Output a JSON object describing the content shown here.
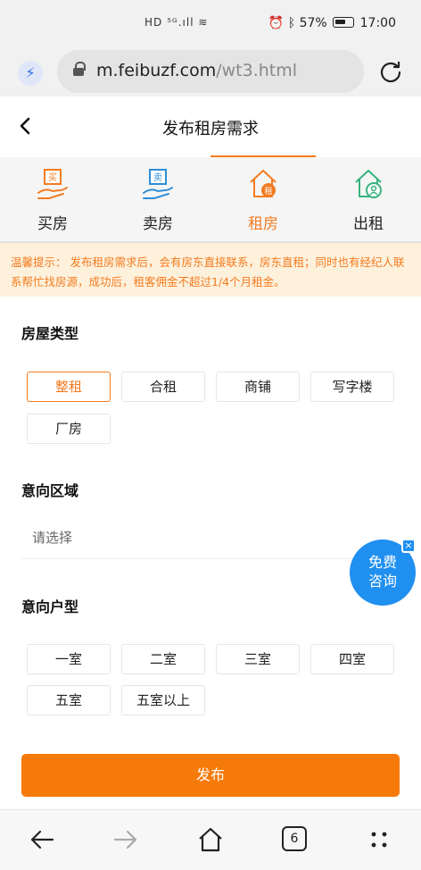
{
  "status_bar": {
    "signal_text": "HD ⁵ᴳ.ıll ≋",
    "battery_text": "57%",
    "time": "17:00"
  },
  "address_bar": {
    "host": "m.feibuzf.com",
    "path": "/wt3.html"
  },
  "header": {
    "title": "发布租房需求"
  },
  "categories": [
    {
      "label": "买房",
      "icon": "buy-house-icon",
      "color": "#f47b20"
    },
    {
      "label": "卖房",
      "icon": "sell-house-icon",
      "color": "#2f8fd8"
    },
    {
      "label": "租房",
      "icon": "rent-house-icon",
      "color": "#f47b20",
      "active": true
    },
    {
      "label": "出租",
      "icon": "lease-house-icon",
      "color": "#36b37e"
    }
  ],
  "tip": {
    "text": "温馨提示：  发布租房需求后，会有房东直接联系，房东直租；同时也有经纪人联系帮忙找房源，成功后，租客佣金不超过1/4个月租金。"
  },
  "house_type": {
    "title": "房屋类型",
    "options": [
      "整租",
      "合租",
      "商铺",
      "写字楼",
      "厂房"
    ],
    "selected": "整租"
  },
  "area": {
    "title": "意向区域",
    "placeholder": "请选择"
  },
  "room_type": {
    "title": "意向户型",
    "options": [
      "一室",
      "二室",
      "三室",
      "四室",
      "五室",
      "五室以上"
    ]
  },
  "float_button": {
    "line1": "免费",
    "line2": "咨询",
    "close": "×"
  },
  "submit": {
    "label": "发布"
  },
  "browser_nav": {
    "tabs_count": "6"
  },
  "colors": {
    "accent": "#f47b20",
    "tip_bg": "#fdf1dc",
    "float_blue": "#1f8ff0"
  }
}
